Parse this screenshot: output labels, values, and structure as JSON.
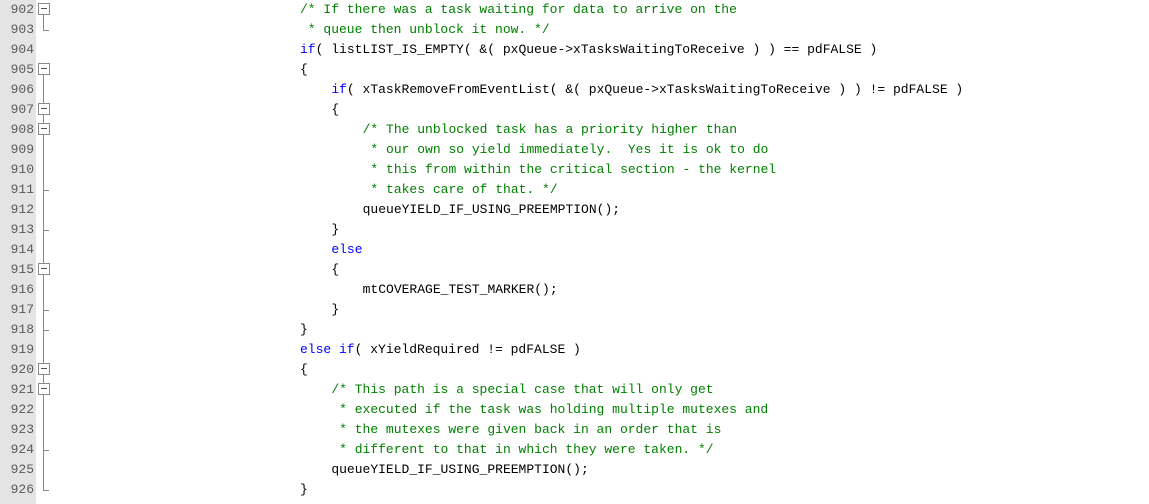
{
  "editor": {
    "lines": [
      {
        "num": "902",
        "fold": "box",
        "indent": 40,
        "parts": [
          {
            "cls": "c",
            "text": "/* If there was a task waiting for data to arrive on the"
          }
        ]
      },
      {
        "num": "903",
        "fold": "end",
        "indent": 40,
        "parts": [
          {
            "cls": "c",
            "text": " * queue then unblock it now. */"
          }
        ]
      },
      {
        "num": "904",
        "fold": "none",
        "indent": 40,
        "parts": [
          {
            "cls": "k",
            "text": "if"
          },
          {
            "cls": "t",
            "text": "( listLIST_IS_EMPTY( &( pxQueue->xTasksWaitingToReceive ) ) == pdFALSE )"
          }
        ]
      },
      {
        "num": "905",
        "fold": "box",
        "indent": 40,
        "parts": [
          {
            "cls": "t",
            "text": "{"
          }
        ]
      },
      {
        "num": "906",
        "fold": "line",
        "indent": 44,
        "parts": [
          {
            "cls": "k",
            "text": "if"
          },
          {
            "cls": "t",
            "text": "( xTaskRemoveFromEventList( &( pxQueue->xTasksWaitingToReceive ) ) != pdFALSE )"
          }
        ]
      },
      {
        "num": "907",
        "fold": "box",
        "indent": 44,
        "parts": [
          {
            "cls": "t",
            "text": "{"
          }
        ]
      },
      {
        "num": "908",
        "fold": "box",
        "indent": 48,
        "parts": [
          {
            "cls": "c",
            "text": "/* The unblocked task has a priority higher than"
          }
        ]
      },
      {
        "num": "909",
        "fold": "line",
        "indent": 48,
        "parts": [
          {
            "cls": "c",
            "text": " * our own so yield immediately.  Yes it is ok to do"
          }
        ]
      },
      {
        "num": "910",
        "fold": "line",
        "indent": 48,
        "parts": [
          {
            "cls": "c",
            "text": " * this from within the critical section - the kernel"
          }
        ]
      },
      {
        "num": "911",
        "fold": "end",
        "indent": 48,
        "parts": [
          {
            "cls": "c",
            "text": " * takes care of that. */"
          }
        ]
      },
      {
        "num": "912",
        "fold": "line",
        "indent": 48,
        "parts": [
          {
            "cls": "t",
            "text": "queueYIELD_IF_USING_PREEMPTION();"
          }
        ]
      },
      {
        "num": "913",
        "fold": "end",
        "indent": 44,
        "parts": [
          {
            "cls": "t",
            "text": "}"
          }
        ]
      },
      {
        "num": "914",
        "fold": "line",
        "indent": 44,
        "parts": [
          {
            "cls": "k",
            "text": "else"
          }
        ]
      },
      {
        "num": "915",
        "fold": "box",
        "indent": 44,
        "parts": [
          {
            "cls": "t",
            "text": "{"
          }
        ]
      },
      {
        "num": "916",
        "fold": "line",
        "indent": 48,
        "parts": [
          {
            "cls": "t",
            "text": "mtCOVERAGE_TEST_MARKER();"
          }
        ]
      },
      {
        "num": "917",
        "fold": "end",
        "indent": 44,
        "parts": [
          {
            "cls": "t",
            "text": "}"
          }
        ]
      },
      {
        "num": "918",
        "fold": "end",
        "indent": 40,
        "parts": [
          {
            "cls": "t",
            "text": "}"
          }
        ]
      },
      {
        "num": "919",
        "fold": "line",
        "indent": 40,
        "parts": [
          {
            "cls": "k",
            "text": "else if"
          },
          {
            "cls": "t",
            "text": "( xYieldRequired != pdFALSE )"
          }
        ]
      },
      {
        "num": "920",
        "fold": "box",
        "indent": 40,
        "parts": [
          {
            "cls": "t",
            "text": "{"
          }
        ]
      },
      {
        "num": "921",
        "fold": "box",
        "indent": 44,
        "parts": [
          {
            "cls": "c",
            "text": "/* This path is a special case that will only get"
          }
        ]
      },
      {
        "num": "922",
        "fold": "line",
        "indent": 44,
        "parts": [
          {
            "cls": "c",
            "text": " * executed if the task was holding multiple mutexes and"
          }
        ]
      },
      {
        "num": "923",
        "fold": "line",
        "indent": 44,
        "parts": [
          {
            "cls": "c",
            "text": " * the mutexes were given back in an order that is"
          }
        ]
      },
      {
        "num": "924",
        "fold": "end",
        "indent": 44,
        "parts": [
          {
            "cls": "c",
            "text": " * different to that in which they were taken. */"
          }
        ]
      },
      {
        "num": "925",
        "fold": "line",
        "indent": 44,
        "parts": [
          {
            "cls": "t",
            "text": "queueYIELD_IF_USING_PREEMPTION();"
          }
        ]
      },
      {
        "num": "926",
        "fold": "end",
        "indent": 40,
        "parts": [
          {
            "cls": "t",
            "text": "}"
          }
        ]
      }
    ]
  }
}
